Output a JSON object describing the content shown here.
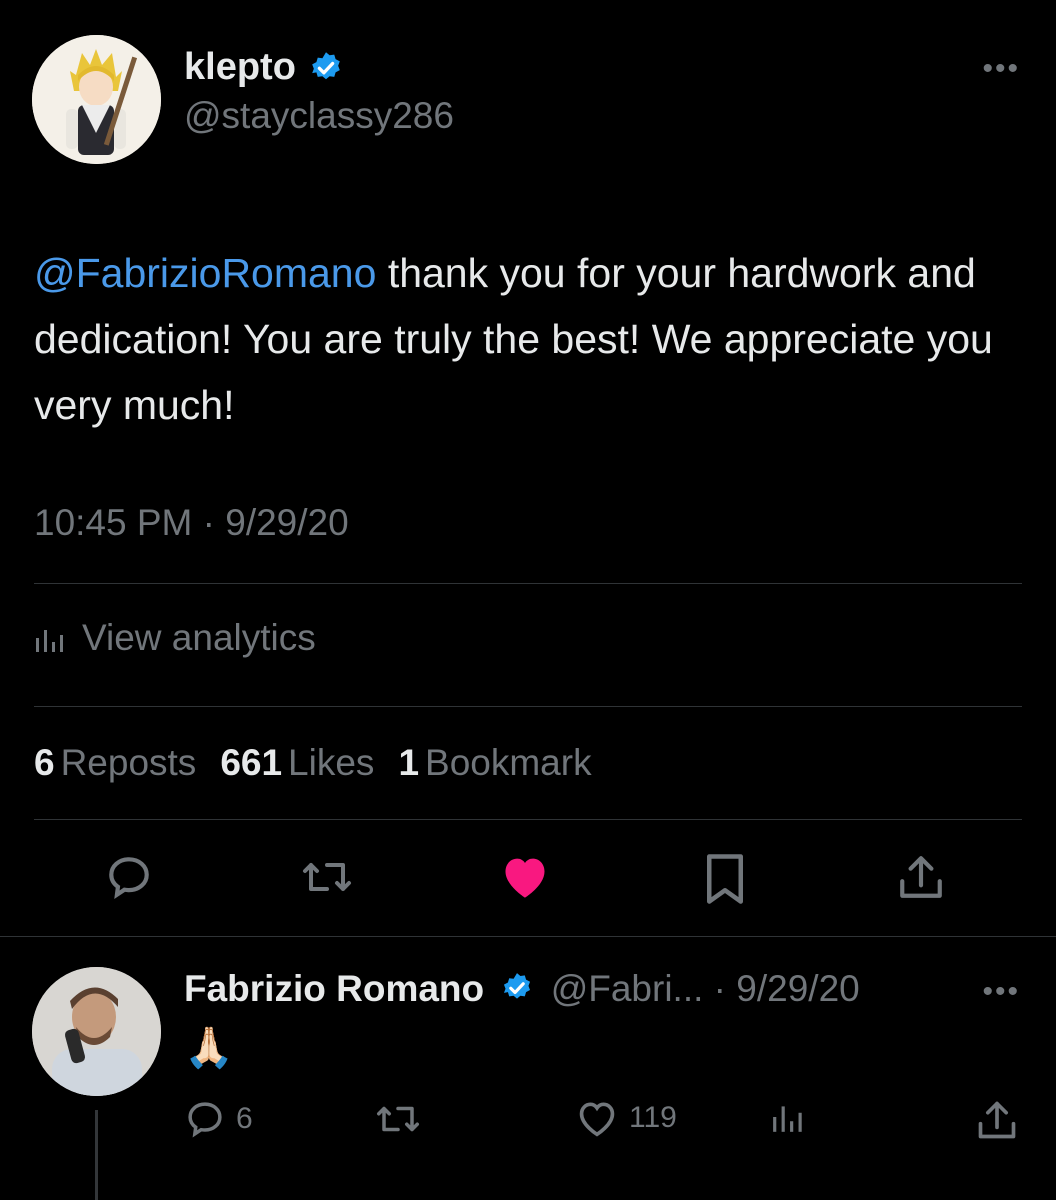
{
  "tweet": {
    "author_name": "klepto",
    "author_handle": "@stayclassy286",
    "mention": "@FabrizioRomano",
    "text": " thank you for your hardwork and dedication! You are truly the best! We appreciate you very much!",
    "timestamp": "10:45 PM · 9/29/20",
    "analytics_label": "View analytics",
    "stats": {
      "reposts_count": "6",
      "reposts_label": "Reposts",
      "likes_count": "661",
      "likes_label": "Likes",
      "bookmarks_count": "1",
      "bookmarks_label": "Bookmark"
    },
    "liked": true
  },
  "reply": {
    "author_name": "Fabrizio Romano",
    "author_handle": "@Fabri...",
    "separator": " · ",
    "date": "9/29/20",
    "text": "🙏🏻",
    "reply_count": "6",
    "like_count": "119"
  },
  "colors": {
    "background": "#000000",
    "text": "#e7e9ea",
    "secondary": "#71767b",
    "accent": "#1d9bf0",
    "mention": "#4a99e9",
    "like": "#f91880",
    "divider": "#2f3336"
  },
  "icons": {
    "verified": "verified-badge-icon",
    "more": "more-icon",
    "analytics": "bar-chart-icon",
    "reply": "reply-icon",
    "repost": "repost-icon",
    "like": "heart-icon",
    "bookmark": "bookmark-icon",
    "share": "share-icon"
  }
}
